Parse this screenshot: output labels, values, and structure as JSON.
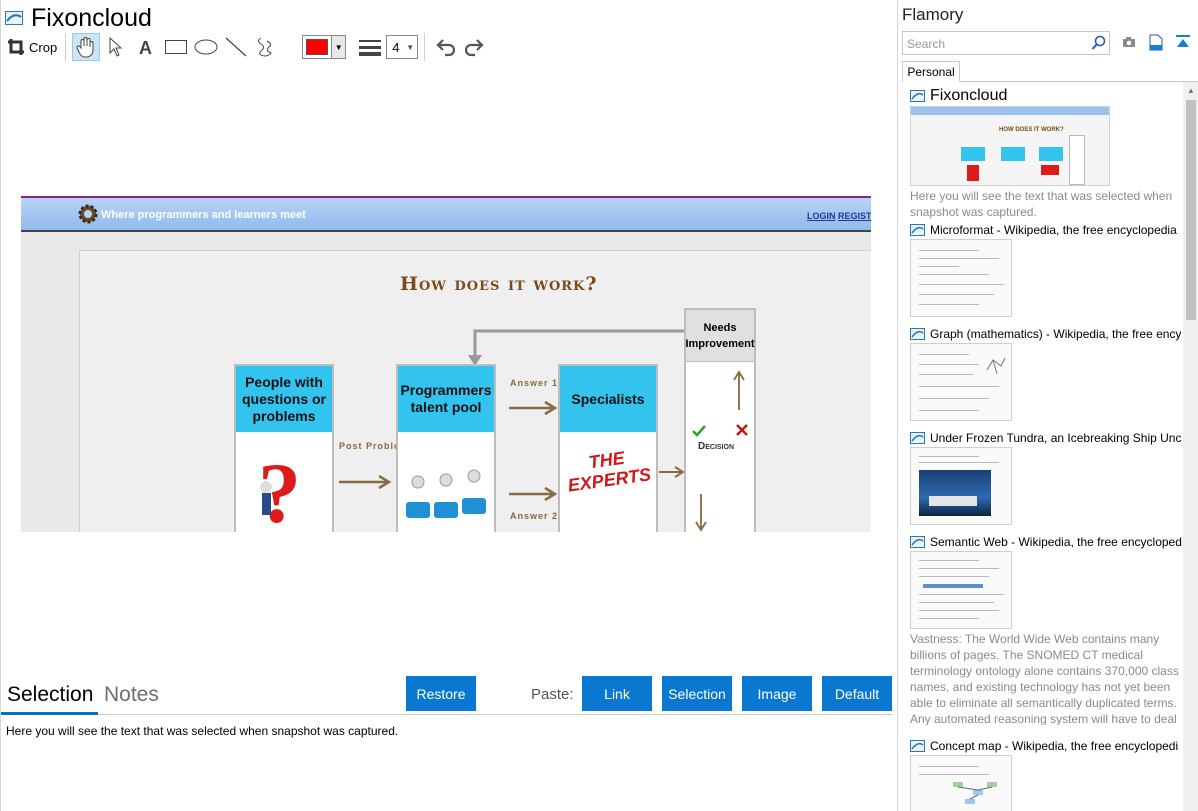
{
  "window": {
    "title": "Fixoncloud"
  },
  "toolbar": {
    "crop_label": "Crop",
    "tools": [
      "crop-icon",
      "hand-icon",
      "pointer-icon",
      "text-icon",
      "rectangle-icon",
      "ellipse-icon",
      "line-icon",
      "freehand-icon"
    ],
    "color": "#ff0000",
    "line_width": "4"
  },
  "snapshot": {
    "tagline": "Where programmers and learners meet",
    "login": "LOGIN",
    "register": "REGISTER",
    "heading": "How does it work?",
    "box1": "People with questions or problems",
    "box2": "Programmers talent pool",
    "box3": "Specialists",
    "box4": "Needs Improvement",
    "post_problems": "Post Problems?",
    "answer1": "Answer 1",
    "answer2": "Answer 2",
    "decision": "Decision",
    "experts": "THE EXPERTS"
  },
  "tabs": {
    "selection": "Selection",
    "notes": "Notes"
  },
  "buttons": {
    "restore": "Restore",
    "paste_label": "Paste:",
    "link": "Link",
    "selection": "Selection",
    "image": "Image",
    "default": "Default"
  },
  "selection_text": "Here you will see the text that was selected when snapshot was captured.",
  "sidebar": {
    "app_name": "Flamory",
    "search_placeholder": "Search",
    "tab_personal": "Personal",
    "items": [
      {
        "label": "Fixoncloud",
        "desc": "Here you will see the text that was selected when snapshot was captured."
      },
      {
        "label": "Microformat - Wikipedia, the free encyclopedia"
      },
      {
        "label": "Graph (mathematics) - Wikipedia, the free ency"
      },
      {
        "label": "Under Frozen Tundra, an Icebreaking Ship Unco"
      },
      {
        "label": "Semantic Web - Wikipedia, the free encycloped",
        "desc": "Vastness: The World Wide Web contains many billions of pages. The SNOMED CT medical terminology ontology alone contains 370,000 class names, and existing technology has not yet been able to eliminate all semantically duplicated terms. Any automated reasoning system will have to deal with truly huge inputs."
      },
      {
        "label": "Concept map - Wikipedia, the free encyclopedi"
      }
    ]
  },
  "colors": {
    "accent": "#0a78d0",
    "tab_underline": "#0a6fc2"
  }
}
